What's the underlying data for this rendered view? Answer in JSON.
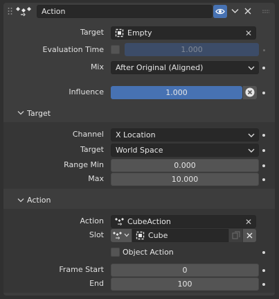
{
  "header": {
    "title": "Action",
    "eye_icon": "eye-icon",
    "chevron_icon": "chevron-down-icon",
    "close_icon": "close-icon",
    "drag_icon": "drag-handle-icon",
    "constraint_icon": "action-constraint-icon"
  },
  "main": {
    "target_label": "Target",
    "target_value": "Empty",
    "eval_time_label": "Evaluation Time",
    "eval_time_value": "1.000",
    "mix_label": "Mix",
    "mix_value": "After Original (Aligned)",
    "influence_label": "Influence",
    "influence_value": "1.000",
    "influence_fraction": 1.0
  },
  "target_section": {
    "title": "Target",
    "channel_label": "Channel",
    "channel_value": "X Location",
    "space_label": "Target",
    "space_value": "World Space",
    "range_min_label": "Range Min",
    "range_min_value": "0.000",
    "max_label": "Max",
    "max_value": "10.000"
  },
  "action_section": {
    "title": "Action",
    "action_label": "Action",
    "action_value": "CubeAction",
    "slot_label": "Slot",
    "slot_value": "Cube",
    "object_action_label": "Object Action",
    "object_action_checked": false,
    "frame_start_label": "Frame Start",
    "frame_start_value": "0",
    "end_label": "End",
    "end_value": "100"
  },
  "colors": {
    "accent": "#4772b3",
    "panel": "#3d3d3d",
    "subpanel": "#363636",
    "field": "#282828",
    "number": "#545454"
  }
}
